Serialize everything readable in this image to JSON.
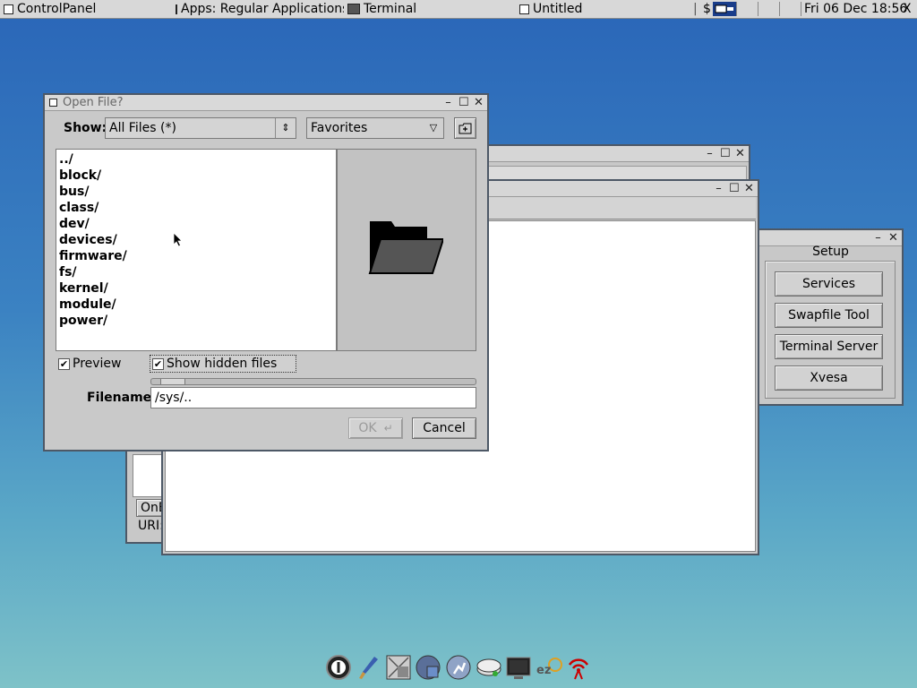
{
  "taskbar": {
    "items": [
      "ControlPanel",
      "Apps: Regular Applications",
      "Terminal",
      "Untitled"
    ],
    "dollar": "$",
    "clock": "Fri 06 Dec 18:56",
    "close_glyph": "X"
  },
  "dialog": {
    "title": "Open File?",
    "show_label": "Show:",
    "filter_value": "All Files (*)",
    "favorites_value": "Favorites",
    "files": [
      "../",
      "block/",
      "bus/",
      "class/",
      "dev/",
      "devices/",
      "firmware/",
      "fs/",
      "kernel/",
      "module/",
      "power/"
    ],
    "preview_label": "Preview",
    "preview_checked": true,
    "hidden_label": "Show hidden files",
    "hidden_checked": true,
    "filename_label": "Filename:",
    "filename_value": "/sys/..",
    "ok_label": "OK",
    "cancel_label": "Cancel"
  },
  "back_window": {
    "button_label": "OnE",
    "uri_label": "URI:"
  },
  "setup": {
    "title": "Setup",
    "buttons": [
      "Services",
      "Swapfile Tool",
      "Terminal Server",
      "Xvesa"
    ]
  },
  "icons": {
    "dock": [
      "power-icon",
      "paint-brush-icon",
      "image-editor-icon",
      "disk-icon",
      "run-icon",
      "drive-icon",
      "terminal-icon",
      "ezremaster-icon",
      "wifi-icon"
    ]
  },
  "colors": {
    "desktop_top": "#2a66b8",
    "desktop_bottom": "#7ec2c8",
    "window_border": "#4d5866"
  }
}
